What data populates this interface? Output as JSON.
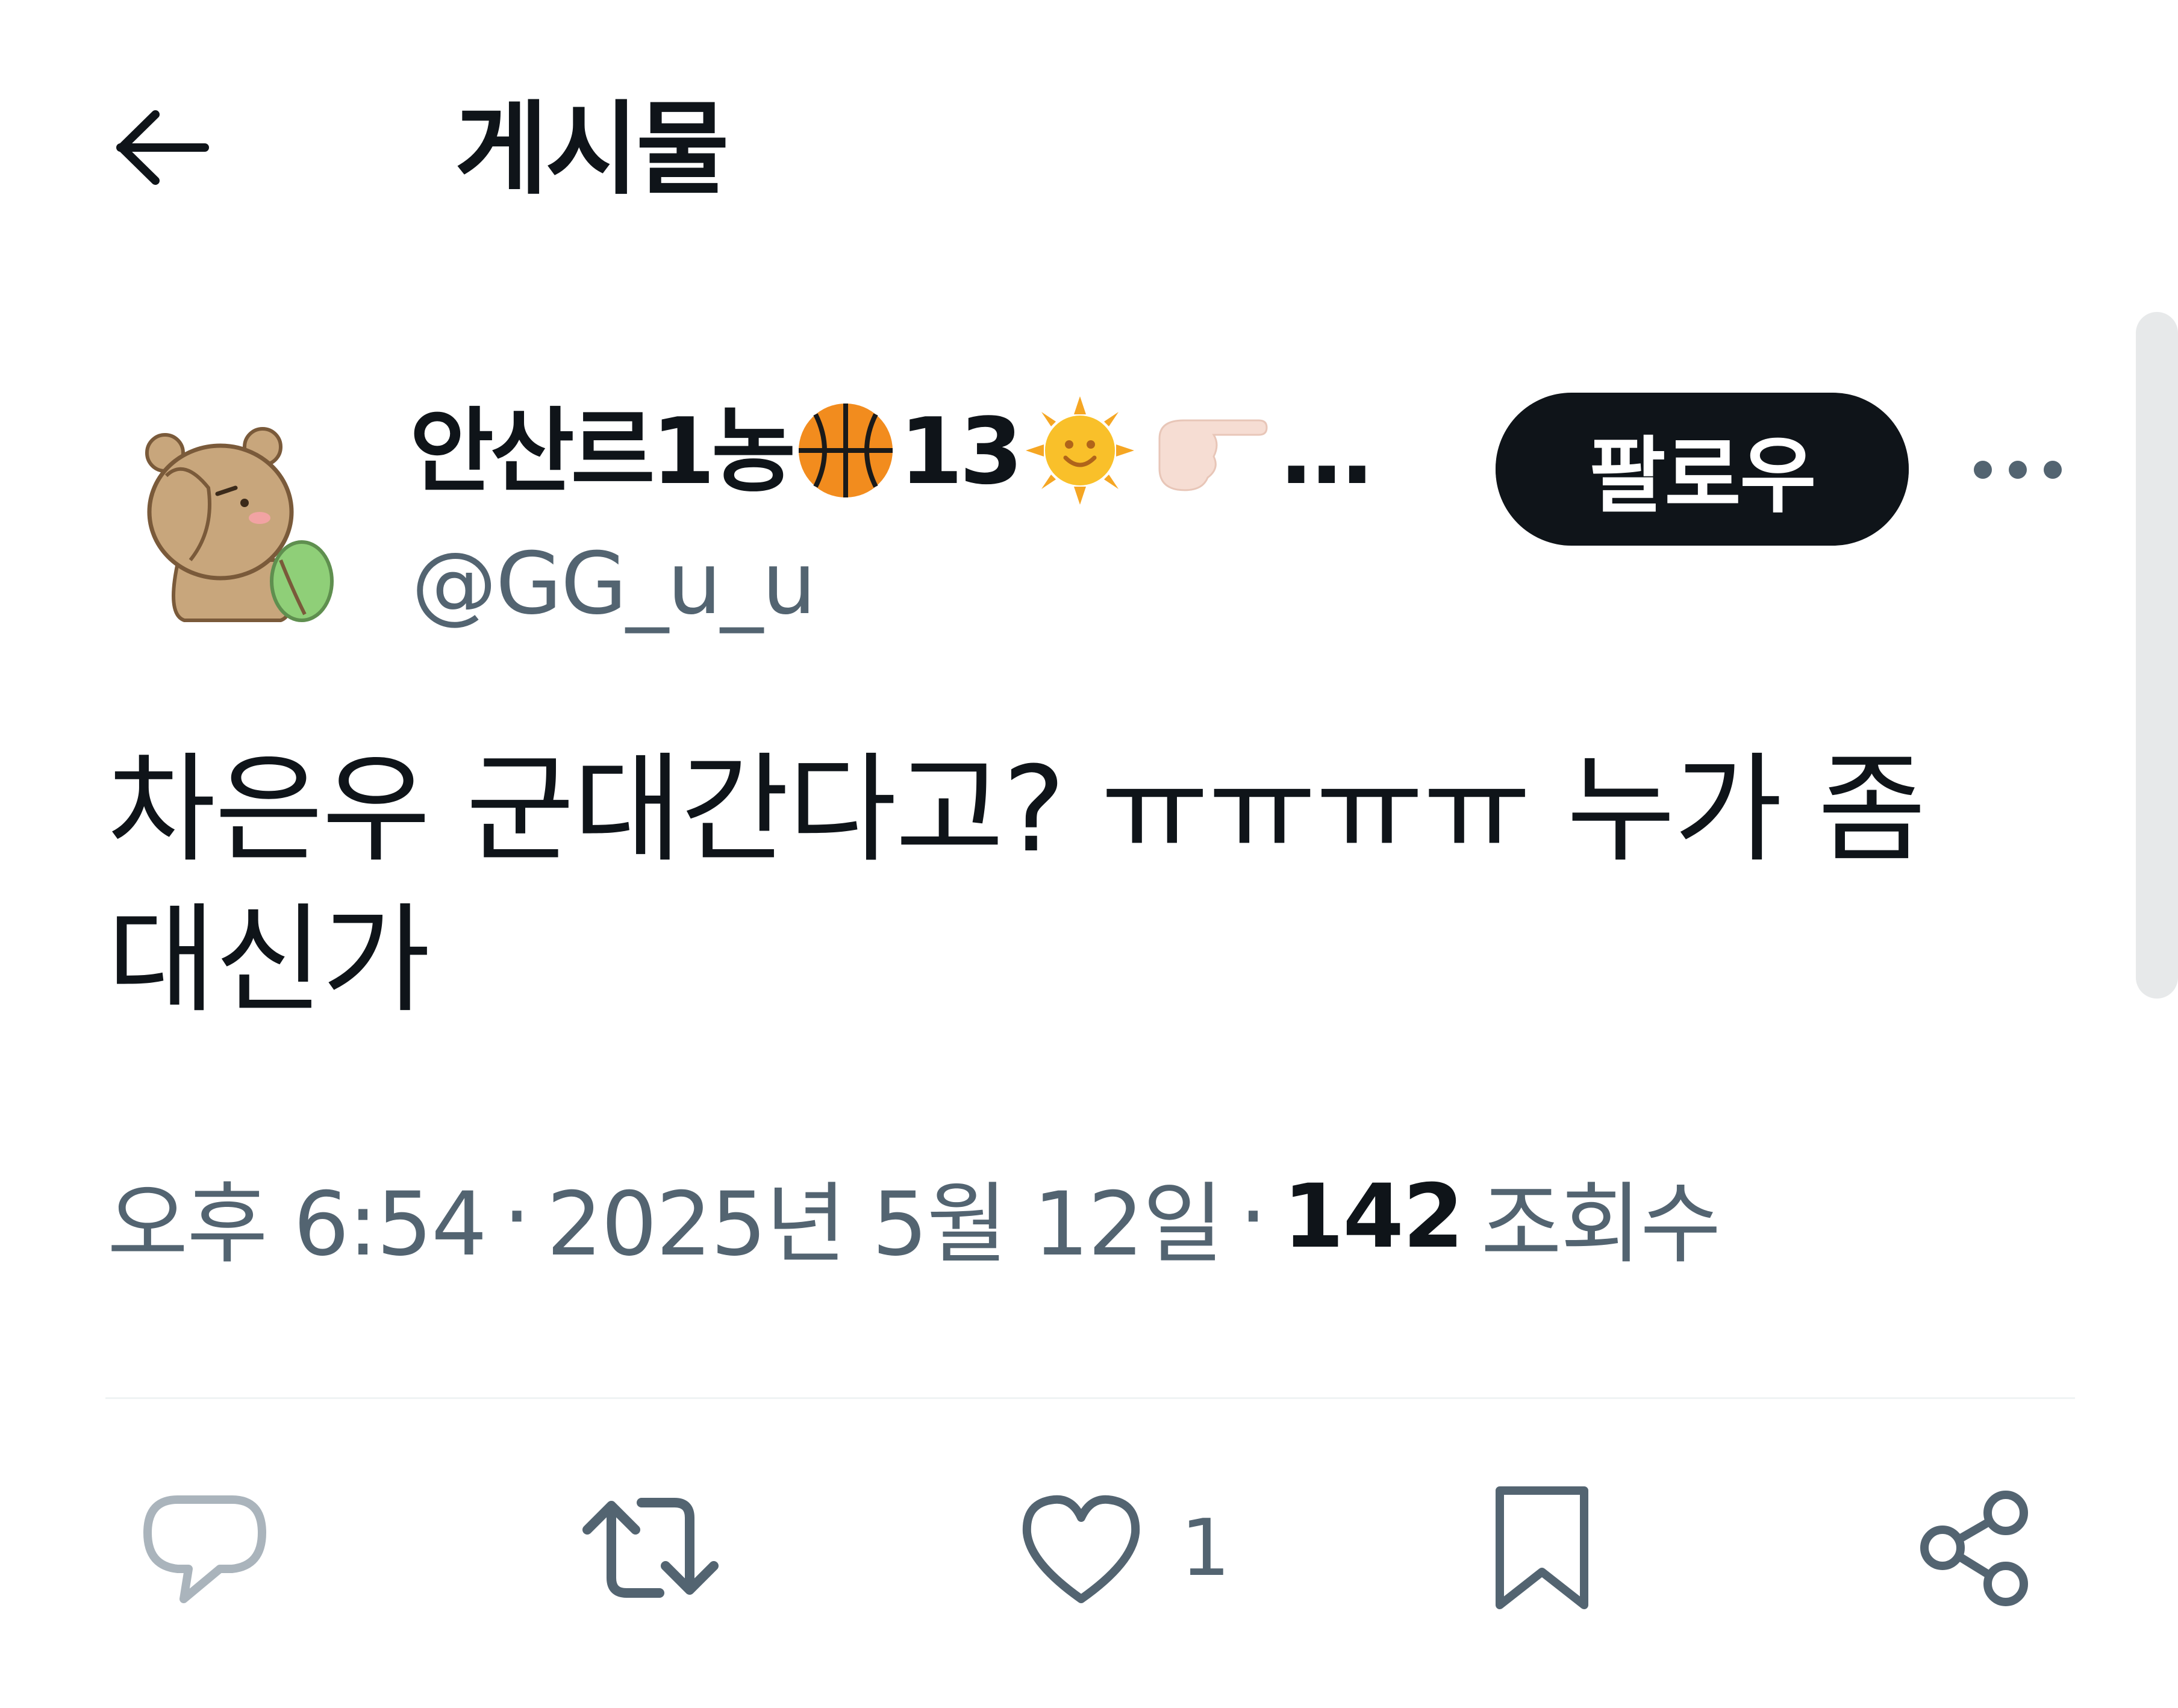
{
  "header": {
    "title": "게시물",
    "back_icon": "arrow-left-icon"
  },
  "author": {
    "display_name": "안산르1농",
    "display_name_suffix": "13",
    "ellipsis": "…",
    "emojis": [
      "basketball-icon",
      "sun-with-face-icon",
      "pointing-right-icon"
    ],
    "handle": "@GG_u_u",
    "avatar": "bear-avatar"
  },
  "follow_button": {
    "label": "팔로우"
  },
  "tweet": {
    "text": "차은우 군대간다고? ㅠㅠㅠㅠ 누가 좀 대신가"
  },
  "meta": {
    "time": "오후 6:54",
    "separator": "·",
    "date": "2025년 5월 12일",
    "views_count": "142",
    "views_label": "조회수"
  },
  "actions": {
    "reply_icon": "reply-icon",
    "retweet_icon": "retweet-icon",
    "like_icon": "heart-icon",
    "like_count": "1",
    "bookmark_icon": "bookmark-icon",
    "share_icon": "share-icon"
  },
  "colors": {
    "text_primary": "#0f1419",
    "text_secondary": "#536471",
    "follow_bg": "#0f1419",
    "divider": "#eff3f4",
    "basketball": "#f28c1e",
    "sun": "#f9c02a"
  }
}
